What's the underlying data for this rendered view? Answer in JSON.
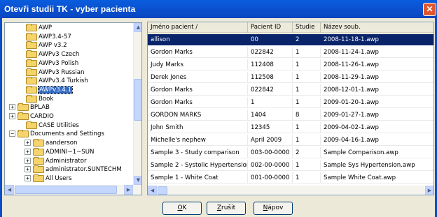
{
  "window": {
    "title": "Otevři studii TK - vyber pacienta",
    "close_glyph": "✕"
  },
  "tree": {
    "items": [
      {
        "label": "AWP",
        "level": 2,
        "expander": null,
        "selected": false
      },
      {
        "label": "AWP3.4-57",
        "level": 2,
        "expander": null,
        "selected": false
      },
      {
        "label": "AWP v3.2",
        "level": 2,
        "expander": null,
        "selected": false
      },
      {
        "label": "AWPv3 Czech",
        "level": 2,
        "expander": null,
        "selected": false
      },
      {
        "label": "AWPv3 Polish",
        "level": 2,
        "expander": null,
        "selected": false
      },
      {
        "label": "AWPv3 Russian",
        "level": 2,
        "expander": null,
        "selected": false
      },
      {
        "label": "AWPv3.4 Turkish",
        "level": 2,
        "expander": null,
        "selected": false
      },
      {
        "label": "AWPv3.4.1",
        "level": 2,
        "expander": null,
        "selected": true
      },
      {
        "label": "Book",
        "level": 2,
        "expander": null,
        "selected": false
      },
      {
        "label": "BPLAB",
        "level": 1,
        "expander": "+",
        "selected": false
      },
      {
        "label": "CARDIO",
        "level": 1,
        "expander": "+",
        "selected": false
      },
      {
        "label": "CASE Utilities",
        "level": 2,
        "expander": null,
        "selected": false
      },
      {
        "label": "Documents and Settings",
        "level": 1,
        "expander": "−",
        "selected": false
      },
      {
        "label": "aanderson",
        "level": 3,
        "expander": "+",
        "selected": false
      },
      {
        "label": "ADMINI~1~SUN",
        "level": 3,
        "expander": "+",
        "selected": false
      },
      {
        "label": "Administrator",
        "level": 3,
        "expander": "+",
        "selected": false
      },
      {
        "label": "administrator.SUNTECHM",
        "level": 3,
        "expander": "+",
        "selected": false
      },
      {
        "label": "All Users",
        "level": 3,
        "expander": "+",
        "selected": false
      }
    ]
  },
  "table": {
    "headers": [
      "Jméno pacient /",
      "Pacient ID",
      "Studie",
      "Název soub."
    ],
    "rows": [
      [
        "allison",
        "00",
        "2",
        "2008-11-18-1.awp"
      ],
      [
        "Gordon Marks",
        "022842",
        "1",
        "2008-11-24-1.awp"
      ],
      [
        "Judy Marks",
        "112408",
        "1",
        "2008-11-26-1.awp"
      ],
      [
        "Derek Jones",
        "112508",
        "1",
        "2008-11-29-1.awp"
      ],
      [
        "Gordon Marks",
        "022842",
        "1",
        "2008-12-01-1.awp"
      ],
      [
        "Gordon Marks",
        "1",
        "1",
        "2009-01-20-1.awp"
      ],
      [
        "GORDON MARKS",
        "1404",
        "8",
        "2009-01-27-1.awp"
      ],
      [
        "John Smith",
        "12345",
        "1",
        "2009-04-02-1.awp"
      ],
      [
        "Michelle's nephew",
        "April 2009",
        "1",
        "2009-04-16-1.awp"
      ],
      [
        "Sample 3 - Study comparison",
        "003-00-0000",
        "2",
        "Sample Comparison.awp"
      ],
      [
        "Sample 2 - Systolic Hypertension",
        "002-00-0000",
        "1",
        "Sample Sys Hypertension.awp"
      ],
      [
        "Sample 1 - White Coat",
        "001-00-0000",
        "1",
        "Sample White Coat.awp"
      ]
    ],
    "selected_row": 0
  },
  "buttons": {
    "ok": {
      "accel": "O",
      "rest": "K"
    },
    "cancel": {
      "accel": "Z",
      "rest": "rušit"
    },
    "help": {
      "accel": "N",
      "rest": "ápov"
    }
  },
  "icons": {
    "scroll_up": "▲",
    "scroll_down": "▼",
    "scroll_left": "◀",
    "scroll_right": "▶"
  },
  "colors": {
    "titlebar": "#0a4ecb",
    "selection": "#0a246a",
    "tree_selection": "#316ac5",
    "close": "#e0562e"
  }
}
